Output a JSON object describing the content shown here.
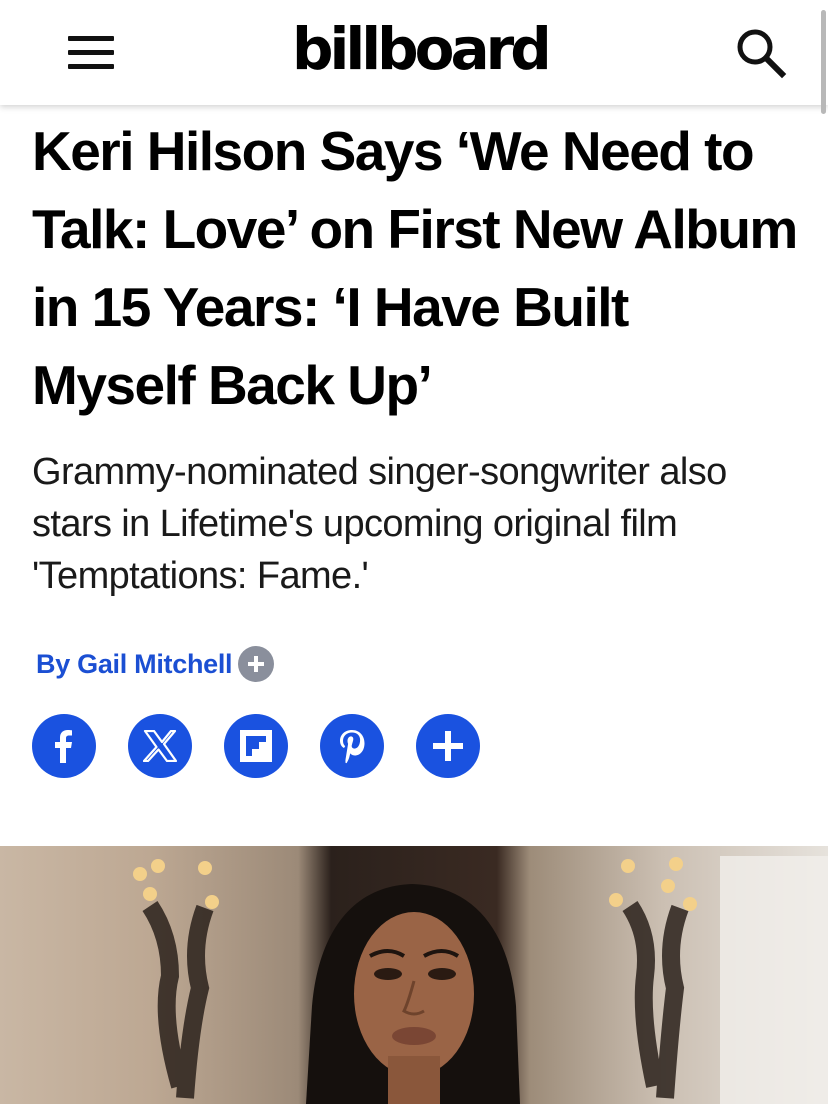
{
  "header": {
    "logo_text": "billboard",
    "menu_icon": "hamburger-icon",
    "search_icon": "search-icon"
  },
  "article": {
    "headline": "Keri Hilson Says ‘We Need to Talk: Love’ on First New Album in 15 Years: ‘I Have Built Myself Back Up’",
    "dek": "Grammy-nominated singer-songwriter also stars in Lifetime's upcoming original film 'Temptations: Fame.'",
    "byline": "By Gail Mitchell"
  },
  "share": [
    {
      "name": "facebook",
      "icon": "facebook-icon"
    },
    {
      "name": "x",
      "icon": "x-icon"
    },
    {
      "name": "flipboard",
      "icon": "flipboard-icon"
    },
    {
      "name": "pinterest",
      "icon": "pinterest-icon"
    },
    {
      "name": "more",
      "icon": "plus-icon"
    }
  ],
  "colors": {
    "accent_blue": "#1a52e0",
    "byline_blue": "#1b4fd3",
    "follow_gray": "#8a8f9c"
  }
}
